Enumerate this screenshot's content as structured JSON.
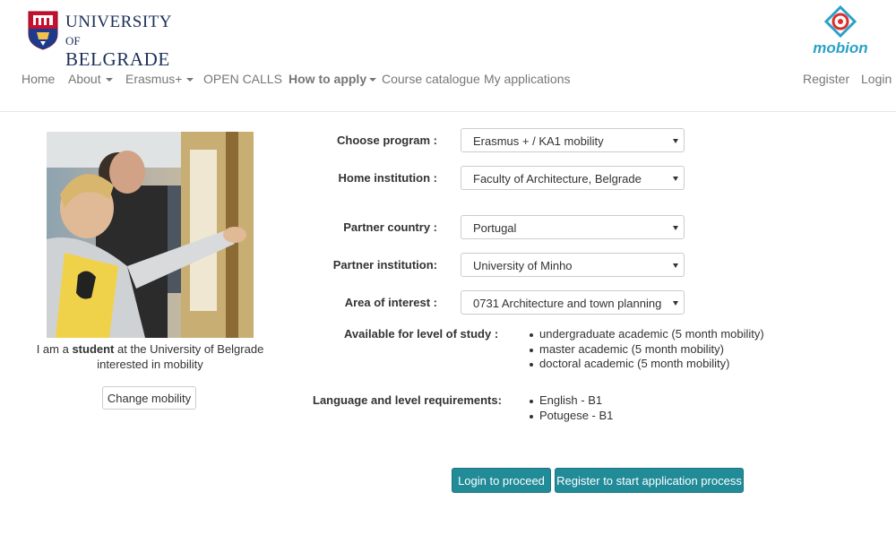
{
  "logo": {
    "line1": "UNIVERSITY",
    "line1_small": "OF",
    "line2": "BELGRADE"
  },
  "brand": {
    "name": "mobion",
    "color": "#2aa1c7"
  },
  "nav": {
    "home": "Home",
    "about": "About",
    "erasmus": "Erasmus+",
    "open_calls": "OPEN CALLS",
    "how_to_apply": "How to apply",
    "course_catalogue": "Course catalogue",
    "my_applications": "My applications",
    "register": "Register",
    "login": "Login"
  },
  "profile": {
    "caption_pre": "I am a ",
    "caption_bold": "student",
    "caption_post": " at the University of Belgrade interested in mobility",
    "change_button": "Change mobility"
  },
  "form": {
    "program_label": "Choose program :",
    "program_value": "Erasmus + / KA1 mobility",
    "home_label": "Home institution :",
    "home_value": "Faculty of Architecture, Belgrade",
    "country_label": "Partner country :",
    "country_value": "Portugal",
    "partner_label": "Partner institution:",
    "partner_value": "University of Minho",
    "area_label": "Area of interest :",
    "area_value": "0731 Architecture and town planning"
  },
  "study_levels": {
    "label": "Available for level of study :",
    "items": [
      "undergraduate academic (5 month mobility)",
      "master academic (5 month mobility)",
      "doctoral academic (5 month mobility)"
    ]
  },
  "language": {
    "label": "Language and level requirements:",
    "items": [
      "English - B1",
      "Potugese - B1"
    ]
  },
  "actions": {
    "login": "Login to proceed",
    "register": "Register to start application process",
    "accent_color": "#218b98"
  }
}
